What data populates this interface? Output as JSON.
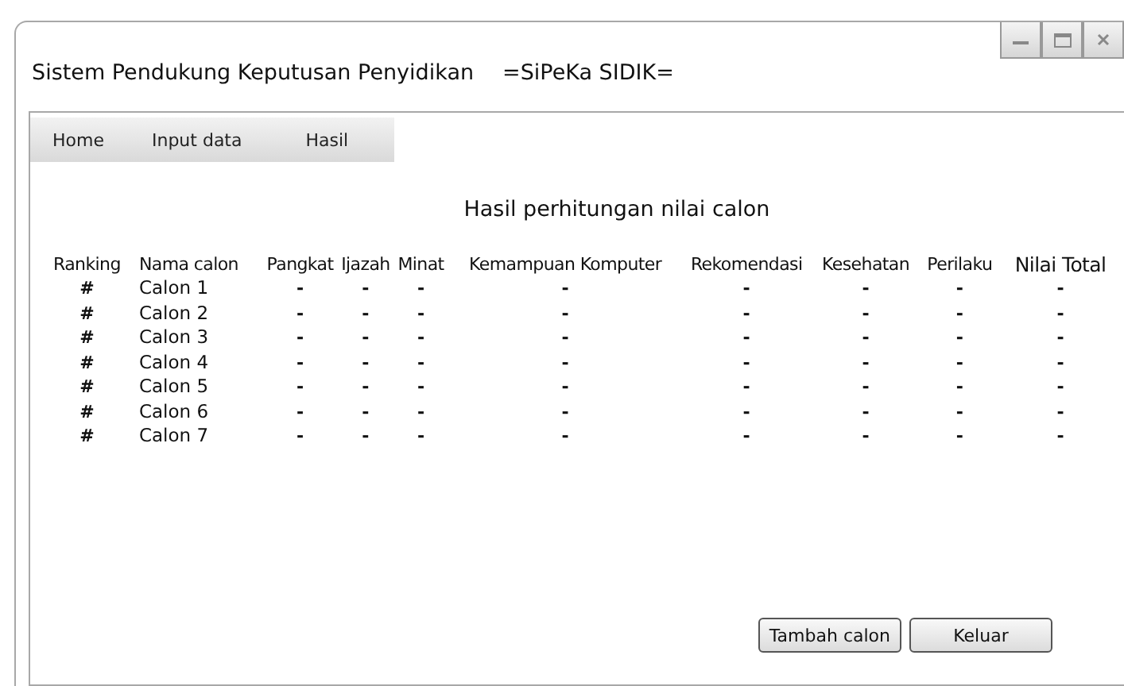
{
  "window": {
    "title": "Sistem Pendukung Keputusan Penyidikan",
    "subtitle": "=SiPeKa SIDIK="
  },
  "menu": [
    {
      "label": "Home",
      "selected": false
    },
    {
      "label": "Input data",
      "selected": false
    },
    {
      "label": "Hasil",
      "selected": false
    }
  ],
  "heading": "Hasil perhitungan nilai calon",
  "table": {
    "columns": [
      "Ranking",
      "Nama calon",
      "Pangkat",
      "Ijazah",
      "Minat",
      "Kemampuan Komputer",
      "Rekomendasi",
      "Kesehatan",
      "Perilaku",
      "Nilai Total"
    ],
    "rows": [
      [
        "#",
        "Calon 1",
        "-",
        "-",
        "-",
        "-",
        "-",
        "-",
        "-",
        "-"
      ],
      [
        "#",
        "Calon 2",
        "-",
        "-",
        "-",
        "-",
        "-",
        "-",
        "-",
        "-"
      ],
      [
        "#",
        "Calon 3",
        "-",
        "-",
        "-",
        "-",
        "-",
        "-",
        "-",
        "-"
      ],
      [
        "#",
        "Calon 4",
        "-",
        "-",
        "-",
        "-",
        "-",
        "-",
        "-",
        "-"
      ],
      [
        "#",
        "Calon 5",
        "-",
        "-",
        "-",
        "-",
        "-",
        "-",
        "-",
        "-"
      ],
      [
        "#",
        "Calon 6",
        "-",
        "-",
        "-",
        "-",
        "-",
        "-",
        "-",
        "-"
      ],
      [
        "#",
        "Calon 7",
        "-",
        "-",
        "-",
        "-",
        "-",
        "-",
        "-",
        "-"
      ]
    ]
  },
  "buttons": [
    "Tambah calon",
    "Keluar"
  ]
}
